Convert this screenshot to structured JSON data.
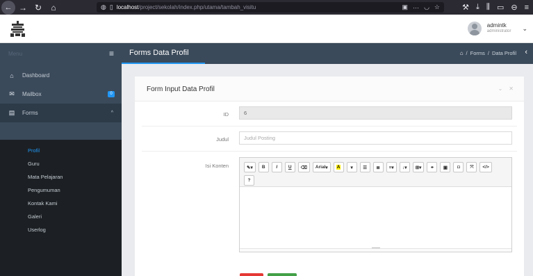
{
  "browser": {
    "url_host": "localhost",
    "url_path": "/project/sekolah/index.php/utama/tambah_visitu",
    "icons": [
      "back-icon",
      "forward-icon",
      "reload-icon",
      "home-icon",
      "shield-icon",
      "page-icon",
      "reader-icon",
      "more-icon",
      "pocket-icon",
      "star-icon",
      "tools-icon",
      "download-icon",
      "library-icon",
      "sidebar-icon",
      "account-icon",
      "menu-icon"
    ]
  },
  "user": {
    "name": "admintk",
    "role": "administrator"
  },
  "sidebar": {
    "brand": "Menu",
    "items": [
      {
        "label": "Dashboard",
        "icon": "home-icon"
      },
      {
        "label": "Mailbox",
        "icon": "mail-icon",
        "badge": "0"
      },
      {
        "label": "Forms",
        "icon": "forms-icon"
      }
    ],
    "sub_items": [
      {
        "label": "Profil"
      },
      {
        "label": "Guru"
      },
      {
        "label": "Mata Pelajaran"
      },
      {
        "label": "Pengumuman"
      },
      {
        "label": "Kontak Kami"
      },
      {
        "label": "Galeri"
      },
      {
        "label": "Userlog"
      }
    ]
  },
  "header": {
    "title": "Forms Data Profil",
    "breadcrumb": [
      "Forms",
      "Data Profil"
    ]
  },
  "card": {
    "title": "Form Input Data Profil",
    "fields": {
      "id_label": "ID",
      "id_value": "6",
      "judul_label": "Judul",
      "judul_placeholder": "Judul Posting",
      "konten_label": "Isi Konten"
    },
    "toolbar": {
      "font_name": "Arial",
      "highlight_label": "A",
      "help_label": "?"
    }
  },
  "colors": {
    "sidebar_dark": "#1c2024",
    "header_slate": "#3b4a5a",
    "accent_blue": "#2196f3",
    "delete_red": "#e53935",
    "save_green": "#43a047"
  }
}
